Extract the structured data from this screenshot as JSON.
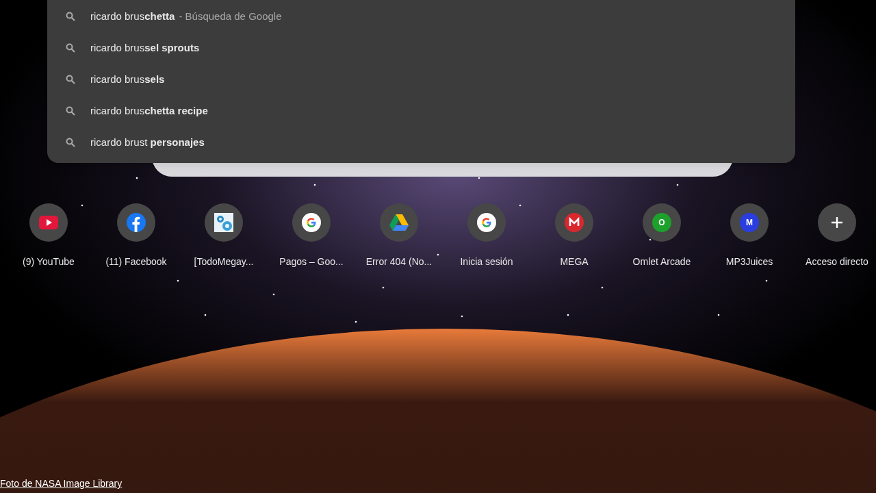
{
  "suggestions": [
    {
      "text": "ricardo brus**chetta**",
      "detail": "- Búsqueda de Google"
    },
    {
      "text": "ricardo brus**sel sprouts**"
    },
    {
      "text": "ricardo brus**sels**"
    },
    {
      "text": "ricardo brus**chetta recipe**"
    },
    {
      "text": "ricardo brust **personajes**"
    }
  ],
  "shortcuts": [
    {
      "label": "(9) YouTube",
      "kind": "youtube"
    },
    {
      "label": "(11) Facebook",
      "kind": "facebook"
    },
    {
      "label": "[TodoMegay...",
      "kind": "gears"
    },
    {
      "label": "Pagos – Goo...",
      "kind": "google"
    },
    {
      "label": "Error 404 (No...",
      "kind": "drive"
    },
    {
      "label": "Inicia sesión",
      "kind": "google"
    },
    {
      "label": "MEGA",
      "kind": "mega"
    },
    {
      "label": "Omlet Arcade",
      "kind": "letter",
      "letter": "O",
      "color": "#1ea02c"
    },
    {
      "label": "MP3Juices",
      "kind": "letter",
      "letter": "M",
      "color": "#2a3ee0"
    },
    {
      "label": "Acceso directo",
      "kind": "add"
    }
  ],
  "photo_credit": "Foto de NASA Image Library"
}
